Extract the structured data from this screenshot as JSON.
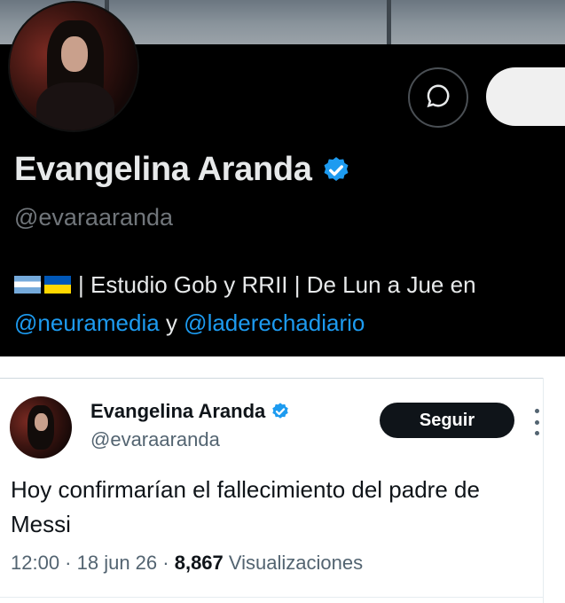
{
  "profile": {
    "display_name": "Evangelina Aranda",
    "handle": "@evaraaranda",
    "bio": {
      "flags": [
        "argentina-flag",
        "ukraine-flag"
      ],
      "text_main": "| Estudio Gob y RRII | De Lun a Jue en",
      "mention_1": "@neuramedia",
      "connector": " y ",
      "mention_2": "@laderechadiario"
    },
    "icons": {
      "message": "message-circle-icon",
      "verified": "verified-badge-icon"
    }
  },
  "tweet": {
    "author_name": "Evangelina Aranda",
    "author_handle": "@evaraaranda",
    "follow_label": "Seguir",
    "text": "Hoy confirmarían el fallecimiento del padre de Messi",
    "time": "12:00",
    "separator": " · ",
    "date": "18 jun 26",
    "views_count": "8,867",
    "views_label": " Visualizaciones"
  },
  "colors": {
    "accent": "#1d9bf0",
    "dark_bg": "#000000",
    "verified": "#1d9bf0"
  }
}
